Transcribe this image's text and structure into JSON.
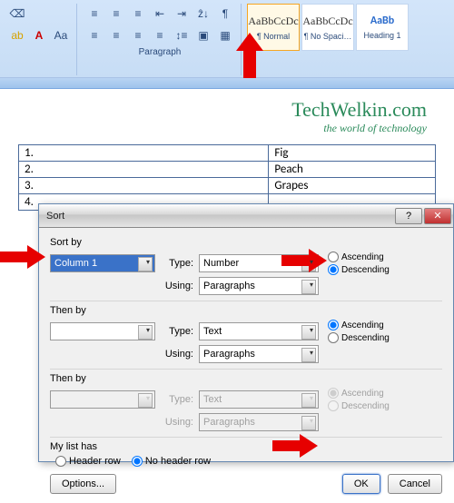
{
  "ribbon": {
    "paragraph_label": "Paragraph",
    "sort_tooltip": "↓A Z"
  },
  "styles": {
    "preview": "AaBbCcDc",
    "preview_heading": "AaBb",
    "normal": "¶ Normal",
    "no_spacing": "¶ No Spaci…",
    "heading1": "Heading 1"
  },
  "brand": {
    "title": "TechWelkin.com",
    "sub": "the world of technology"
  },
  "table": {
    "rows": [
      {
        "num": "1.",
        "val": "Fig"
      },
      {
        "num": "2.",
        "val": "Peach"
      },
      {
        "num": "3.",
        "val": "Grapes"
      },
      {
        "num": "4.",
        "val": ""
      }
    ]
  },
  "dialog": {
    "title": "Sort",
    "sort_by": "Sort by",
    "then_by": "Then by",
    "type": "Type:",
    "using": "Using:",
    "ascending": "Ascending",
    "descending": "Descending",
    "my_list": "My list has",
    "header_row": "Header row",
    "no_header_row": "No header row",
    "options": "Options...",
    "ok": "OK",
    "cancel": "Cancel",
    "sort1": {
      "col": "Column 1",
      "type": "Number",
      "using": "Paragraphs"
    },
    "sort2": {
      "col": "",
      "type": "Text",
      "using": "Paragraphs"
    },
    "sort3": {
      "col": "",
      "type": "Text",
      "using": "Paragraphs"
    }
  }
}
